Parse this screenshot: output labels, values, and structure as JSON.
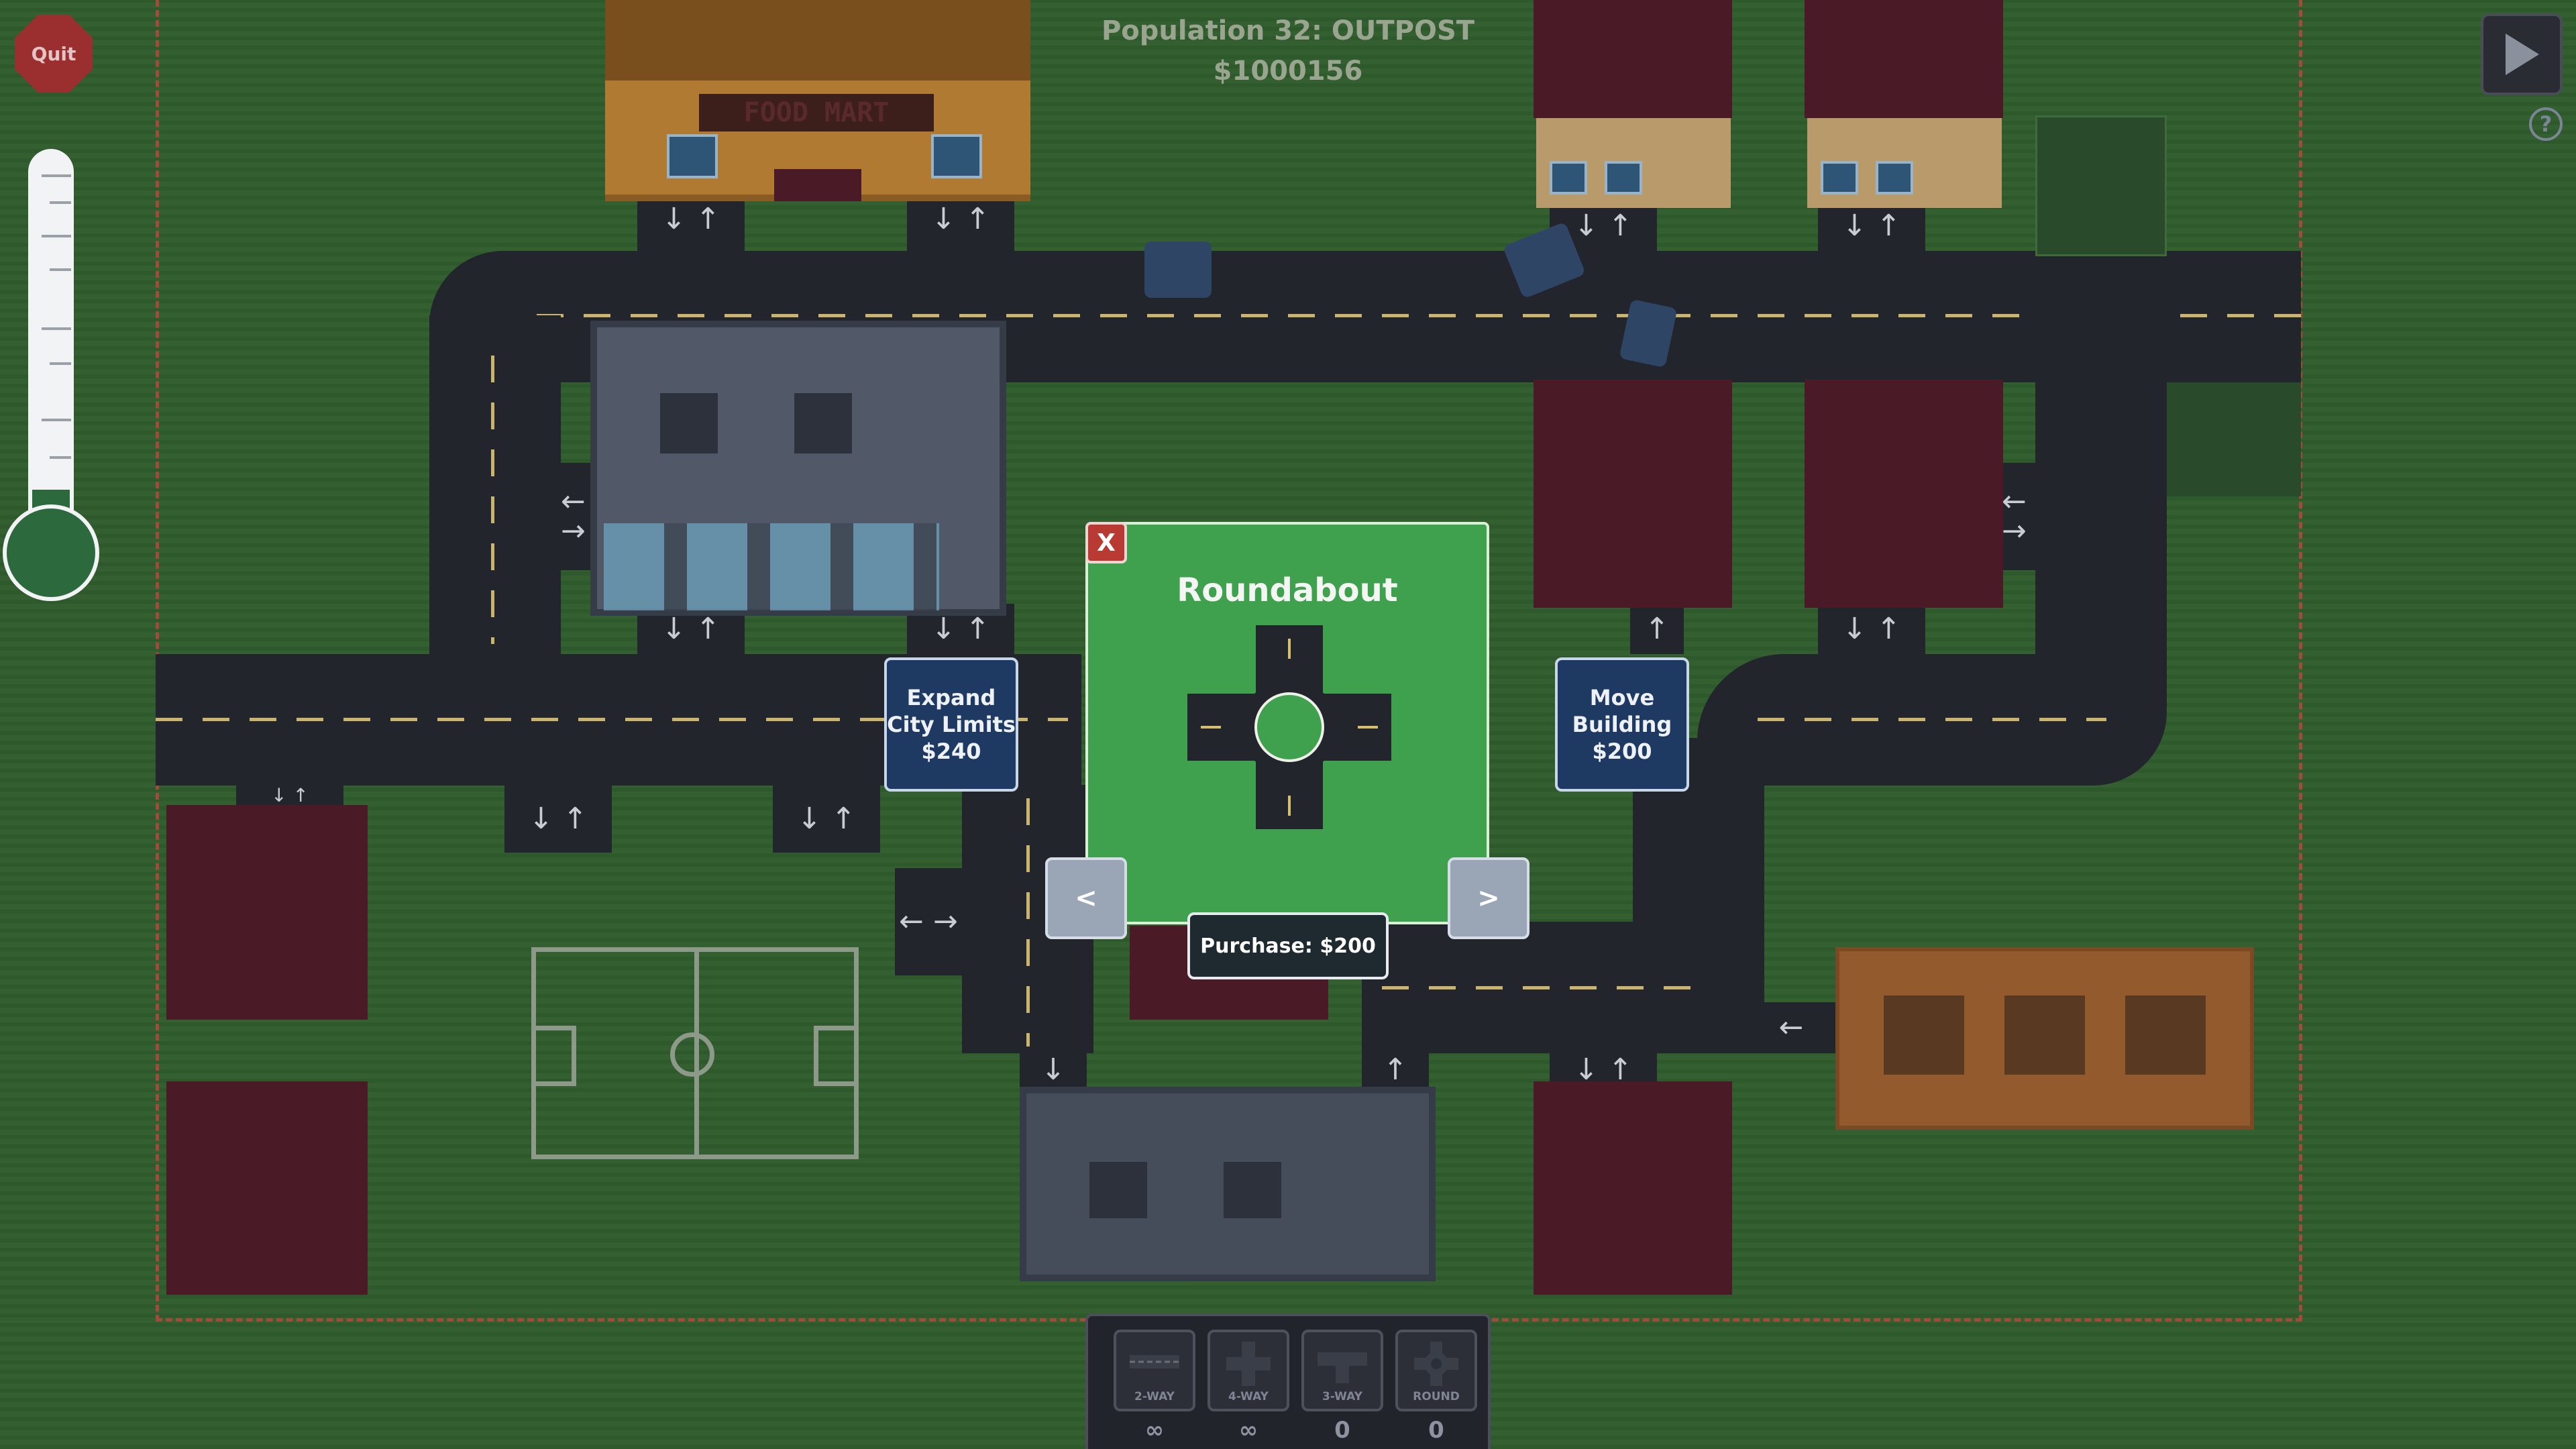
{
  "hud": {
    "population": "Population 32: OUTPOST",
    "money": "$1000156"
  },
  "buttons": {
    "quit": "Quit",
    "help": "?",
    "expand": "Expand\nCity Limits\n$240",
    "move": "Move\nBuilding\n$200"
  },
  "shop": {
    "close": "X",
    "title": "Roundabout",
    "prev": "<",
    "next": ">",
    "purchase": "Purchase: $200"
  },
  "map": {
    "store_sign": "FOOD MART"
  },
  "toolbar": {
    "items": [
      {
        "label": "2-WAY",
        "count": "∞"
      },
      {
        "label": "4-WAY",
        "count": "∞"
      },
      {
        "label": "3-WAY",
        "count": "0"
      },
      {
        "label": "ROUND",
        "count": "0"
      }
    ]
  },
  "colors": {
    "grass": "#305c2d",
    "road": "#23252d",
    "panel": "#3fa14d",
    "action_button": "#1e3a63",
    "close_button": "#b83a33"
  }
}
